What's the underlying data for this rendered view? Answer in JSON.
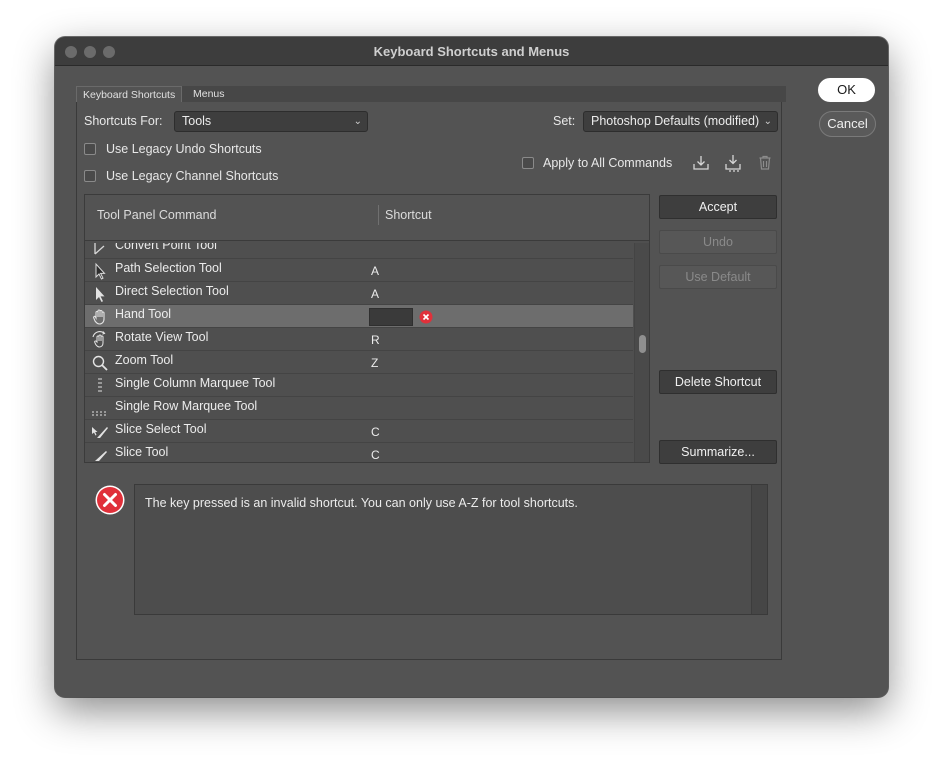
{
  "window": {
    "title": "Keyboard Shortcuts and Menus"
  },
  "tabs": [
    {
      "label": "Keyboard Shortcuts",
      "active": true
    },
    {
      "label": "Menus",
      "active": false
    }
  ],
  "shortcuts_for": {
    "label": "Shortcuts For:",
    "value": "Tools"
  },
  "set": {
    "label": "Set:",
    "value": "Photoshop Defaults (modified)"
  },
  "options": {
    "legacy_undo": {
      "label": "Use Legacy Undo Shortcuts",
      "checked": false
    },
    "legacy_channel": {
      "label": "Use Legacy Channel Shortcuts",
      "checked": false
    },
    "apply_all": {
      "label": "Apply to All Commands",
      "checked": false
    }
  },
  "set_icons": [
    "save-set-icon",
    "save-set-as-icon",
    "delete-set-icon"
  ],
  "table": {
    "col_command": "Tool Panel Command",
    "col_shortcut": "Shortcut",
    "rows": [
      {
        "icon": "convert-point-icon",
        "name": "Convert Point Tool",
        "shortcut": ""
      },
      {
        "icon": "path-selection-icon",
        "name": "Path Selection Tool",
        "shortcut": "A"
      },
      {
        "icon": "direct-selection-icon",
        "name": "Direct Selection Tool",
        "shortcut": "A"
      },
      {
        "icon": "hand-icon",
        "name": "Hand Tool",
        "shortcut": "",
        "selected": true,
        "editing": true
      },
      {
        "icon": "rotate-view-icon",
        "name": "Rotate View Tool",
        "shortcut": "R"
      },
      {
        "icon": "zoom-icon",
        "name": "Zoom Tool",
        "shortcut": "Z"
      },
      {
        "icon": "single-column-marquee-icon",
        "name": "Single Column Marquee Tool",
        "shortcut": ""
      },
      {
        "icon": "single-row-marquee-icon",
        "name": "Single Row Marquee Tool",
        "shortcut": ""
      },
      {
        "icon": "slice-select-icon",
        "name": "Slice Select Tool",
        "shortcut": "C"
      },
      {
        "icon": "slice-icon",
        "name": "Slice Tool",
        "shortcut": "C"
      }
    ]
  },
  "buttons": {
    "accept": "Accept",
    "undo": "Undo",
    "use_default": "Use Default",
    "delete_shortcut": "Delete Shortcut",
    "summarize": "Summarize...",
    "ok": "OK",
    "cancel": "Cancel"
  },
  "message": {
    "icon": "error-icon",
    "text": "The key pressed is an invalid shortcut.  You can only use A-Z for tool shortcuts."
  },
  "colors": {
    "error": "#e0303a",
    "window_bg": "#535353",
    "titlebar_bg": "#3d3d3d"
  }
}
